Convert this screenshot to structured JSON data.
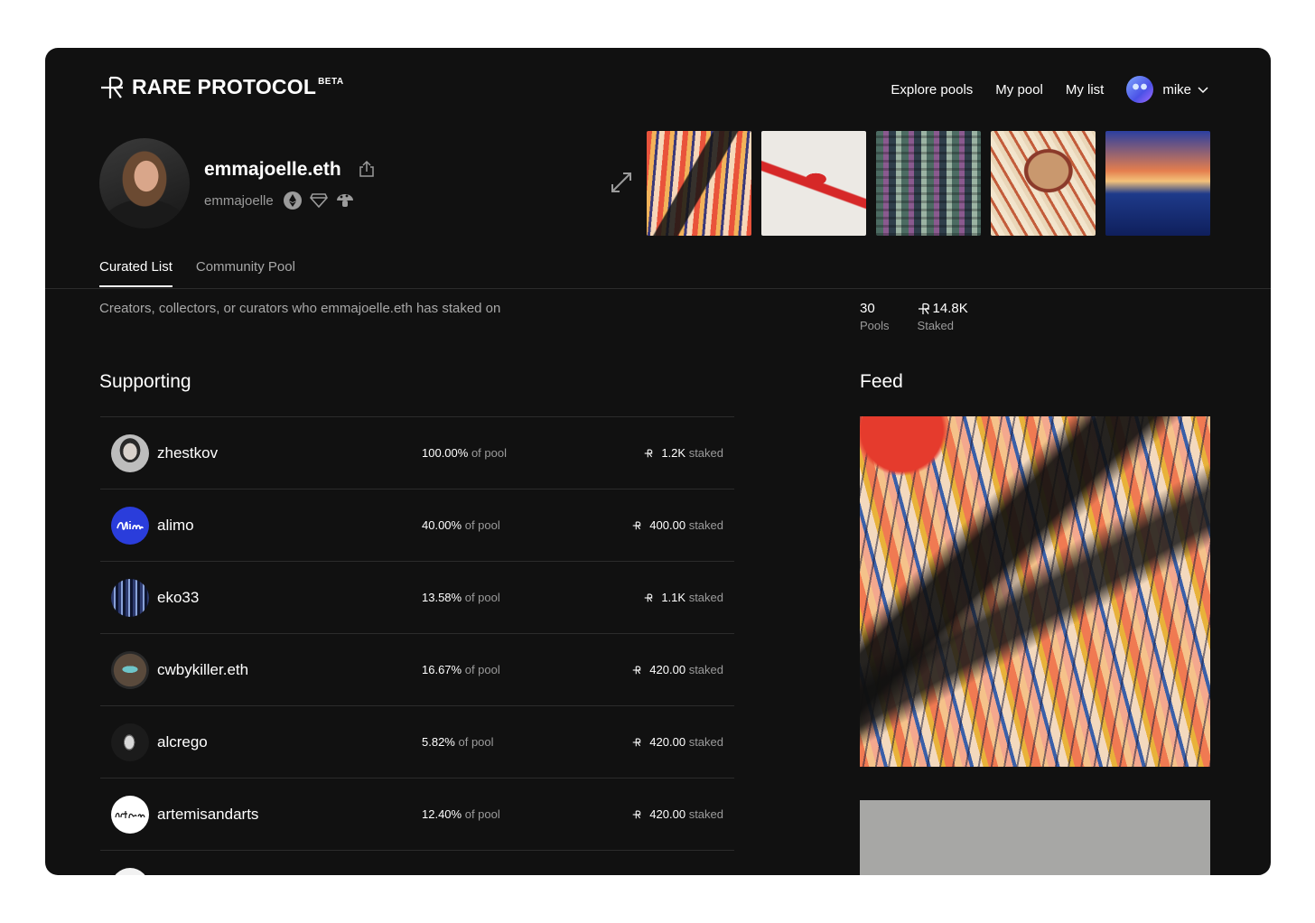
{
  "header": {
    "logo_text": "RARE PROTOCOL",
    "logo_beta": "BETA",
    "nav": [
      "Explore pools",
      "My pool",
      "My list"
    ],
    "user_name": "mike"
  },
  "profile": {
    "name": "emmajoelle.eth",
    "handle": "emmajoelle",
    "badges": [
      "ethereum-badge",
      "diamond-badge",
      "mushroom-badge"
    ]
  },
  "tabs": [
    "Curated List",
    "Community Pool"
  ],
  "subtitle": "Creators, collectors, or curators who emmajoelle.eth has staked on",
  "stats": {
    "pools_value": "30",
    "pools_label": "Pools",
    "staked_value": "14.8K",
    "staked_label": "Staked"
  },
  "supporting": {
    "title": "Supporting",
    "pct_suffix": "of pool",
    "staked_suffix": "staked",
    "rows": [
      {
        "name": "zhestkov",
        "pct": "100.00%",
        "staked": "1.2K"
      },
      {
        "name": "alimo",
        "pct": "40.00%",
        "staked": "400.00"
      },
      {
        "name": "eko33",
        "pct": "13.58%",
        "staked": "1.1K"
      },
      {
        "name": "cwbykiller.eth",
        "pct": "16.67%",
        "staked": "420.00"
      },
      {
        "name": "alcrego",
        "pct": "5.82%",
        "staked": "420.00"
      },
      {
        "name": "artemisandarts",
        "pct": "12.40%",
        "staked": "420.00"
      }
    ]
  },
  "feed": {
    "title": "Feed"
  },
  "colors": {
    "background": "#111111",
    "muted": "#9b9b9b",
    "divider": "#2c2c2c"
  }
}
